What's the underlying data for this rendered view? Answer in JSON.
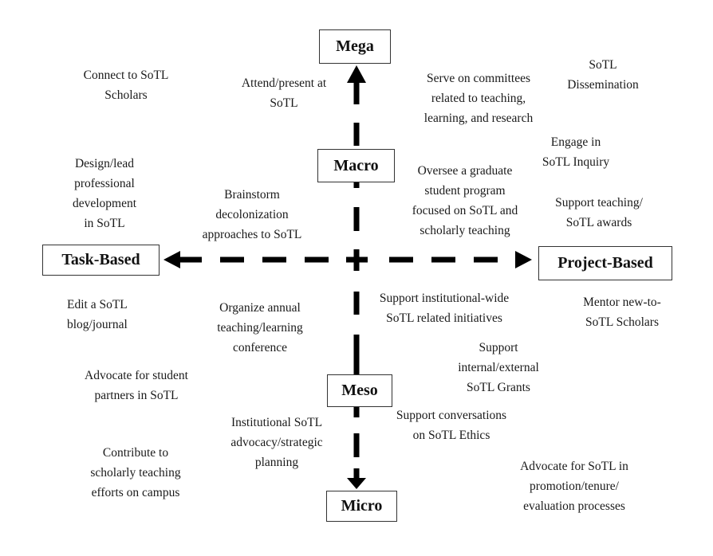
{
  "diagram": {
    "axes": {
      "vertical": {
        "top_label": "Mega",
        "bottom_label": "Micro",
        "mid_labels": [
          "Macro",
          "Meso"
        ]
      },
      "horizontal": {
        "left_label": "Task-Based",
        "right_label": "Project-Based"
      }
    },
    "nodes": {
      "mega": "Mega",
      "macro": "Macro",
      "meso": "Meso",
      "micro": "Micro",
      "task_based": "Task-Based",
      "project_based": "Project-Based"
    },
    "activities": [
      {
        "id": "connect-scholars",
        "text": "Connect to SoTL\nScholars"
      },
      {
        "id": "attend-present",
        "text": "Attend/present at\nSoTL"
      },
      {
        "id": "serve-committees",
        "text": "Serve on committees\nrelated to teaching,\nlearning, and research"
      },
      {
        "id": "sotl-dissemination",
        "text": "SoTL\nDissemination"
      },
      {
        "id": "engage-inquiry",
        "text": "Engage in\nSoTL Inquiry"
      },
      {
        "id": "design-lead-pd",
        "text": "Design/lead\nprofessional\ndevelopment\nin SoTL"
      },
      {
        "id": "brainstorm-decolonization",
        "text": "Brainstorm\ndecolonization\napproaches to SoTL"
      },
      {
        "id": "oversee-graduate-program",
        "text": "Oversee a graduate\nstudent program\nfocused on SoTL and\nscholarly teaching"
      },
      {
        "id": "support-awards",
        "text": "Support teaching/\nSoTL awards"
      },
      {
        "id": "edit-blog-journal",
        "text": "Edit a SoTL\nblog/journal"
      },
      {
        "id": "organize-conference",
        "text": "Organize annual\nteaching/learning\nconference"
      },
      {
        "id": "support-institution-initiatives",
        "text": "Support institutional-wide\nSoTL related initiatives"
      },
      {
        "id": "mentor-new-scholars",
        "text": "Mentor new-to-\nSoTL Scholars"
      },
      {
        "id": "support-grants",
        "text": "Support\ninternal/external\nSoTL Grants"
      },
      {
        "id": "advocate-student-partners",
        "text": "Advocate for student\npartners in SoTL"
      },
      {
        "id": "institutional-advocacy",
        "text": "Institutional SoTL\nadvocacy/strategic\nplanning"
      },
      {
        "id": "support-ethics",
        "text": "Support conversations\non SoTL Ethics"
      },
      {
        "id": "contribute-scholarly-teaching",
        "text": "Contribute to\nscholarly teaching\nefforts on campus"
      },
      {
        "id": "advocate-promotion-tenure",
        "text": "Advocate for SoTL in\npromotion/tenure/\nevaluation processes"
      }
    ],
    "colors": {
      "ink": "#000000",
      "border": "#333333",
      "background": "#ffffff"
    }
  }
}
